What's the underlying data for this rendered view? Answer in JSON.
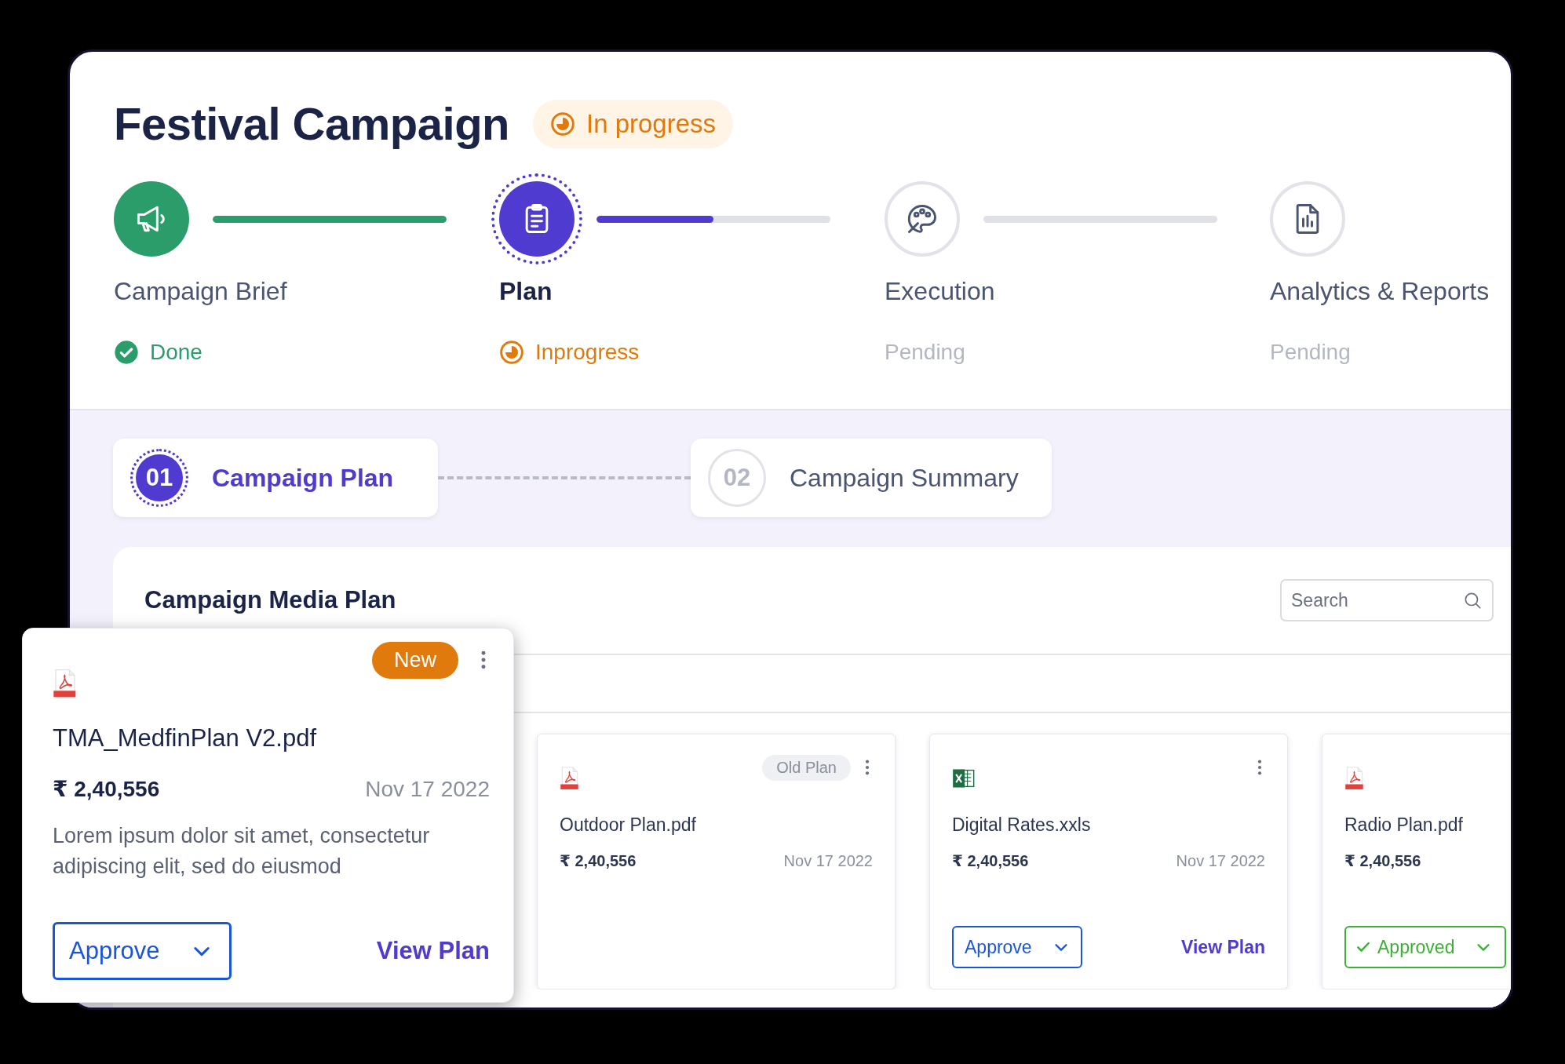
{
  "header": {
    "title": "Festival Campaign",
    "status": "In progress"
  },
  "steps": [
    {
      "label": "Campaign Brief",
      "kind": "done",
      "status": "Done",
      "level": 1
    },
    {
      "label": "Plan",
      "kind": "active",
      "status": "Inprogress",
      "level": 0.5
    },
    {
      "label": "Execution",
      "kind": "pending",
      "status": "Pending",
      "level": 0
    },
    {
      "label": "Analytics & Reports",
      "kind": "pending",
      "status": "Pending"
    }
  ],
  "substeps": [
    {
      "number": "01",
      "label": "Campaign Plan",
      "selected": true
    },
    {
      "number": "02",
      "label": "Campaign Summary",
      "selected": false
    }
  ],
  "media_plan": {
    "title": "Campaign Media Plan",
    "search": {
      "placeholder": "Search"
    },
    "files": [
      {
        "kind": "pdf",
        "tag": {
          "label": "Old Plan",
          "kind": "old"
        },
        "menu": true,
        "name": "Outdoor Plan.pdf",
        "amount": "₹ 2,40,556",
        "date": "Nov 17 2022"
      },
      {
        "kind": "xls",
        "menu": true,
        "name": "Digital Rates.xxls",
        "amount": "₹ 2,40,556",
        "date": "Nov 17 2022",
        "approval": {
          "label": "Approve",
          "approved": false
        },
        "link": "View Plan"
      },
      {
        "kind": "pdf",
        "name": "Radio Plan.pdf",
        "amount": "₹ 2,40,556",
        "approval": {
          "label": "Approved",
          "approved": true
        }
      }
    ]
  },
  "featured_file": {
    "kind": "pdf",
    "tag": {
      "label": "New",
      "kind": "new"
    },
    "menu": true,
    "name": "TMA_MedfinPlan V2.pdf",
    "amount": "₹ 2,40,556",
    "date": "Nov 17 2022",
    "description": "Lorem ipsum dolor sit amet, consectetur adipiscing elit, sed do eiusmod",
    "approval": {
      "label": "Approve",
      "approved": false
    },
    "link": "View Plan"
  }
}
